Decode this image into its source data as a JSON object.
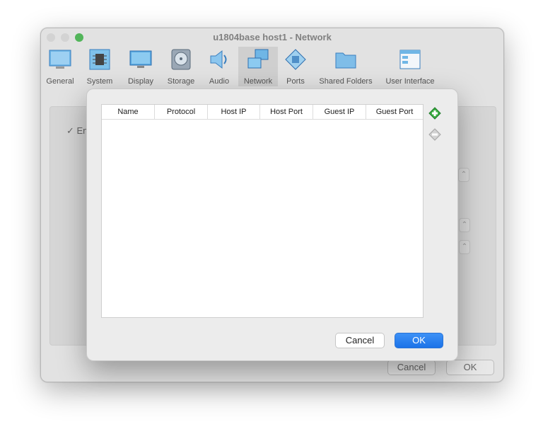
{
  "window": {
    "title": "u1804base host1 - Network"
  },
  "toolbar": {
    "items": [
      {
        "label": "General",
        "icon": "general-icon"
      },
      {
        "label": "System",
        "icon": "chip-icon"
      },
      {
        "label": "Display",
        "icon": "display-icon"
      },
      {
        "label": "Storage",
        "icon": "disk-icon"
      },
      {
        "label": "Audio",
        "icon": "speaker-icon"
      },
      {
        "label": "Network",
        "icon": "network-icon",
        "active": true
      },
      {
        "label": "Ports",
        "icon": "ports-icon"
      },
      {
        "label": "Shared Folders",
        "icon": "folder-icon"
      },
      {
        "label": "User Interface",
        "icon": "user-interface-icon"
      }
    ]
  },
  "background": {
    "enable_check_label": "En",
    "cancel_label": "Cancel",
    "ok_label": "OK"
  },
  "dialog": {
    "columns": [
      "Name",
      "Protocol",
      "Host IP",
      "Host Port",
      "Guest IP",
      "Guest Port"
    ],
    "rows": [],
    "cancel_label": "Cancel",
    "ok_label": "OK",
    "add_rule_icon": "add-rule-icon",
    "remove_rule_icon": "remove-rule-icon"
  },
  "colors": {
    "accent": "#1c73e8",
    "green_dot": "#52b55a",
    "add_icon": "#3cb043"
  }
}
